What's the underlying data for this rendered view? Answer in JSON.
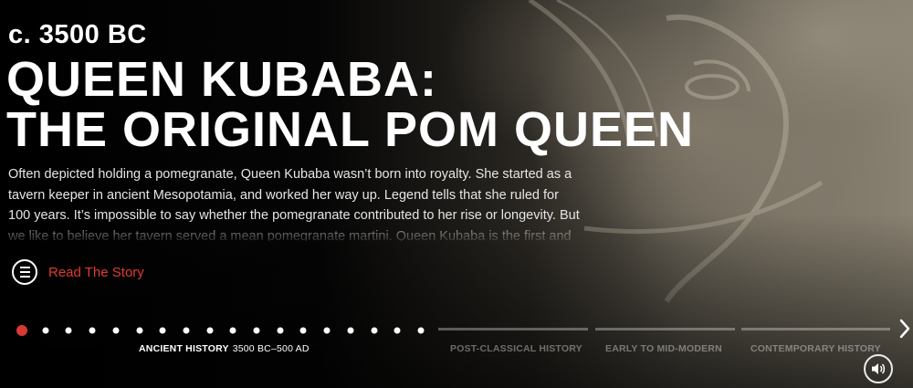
{
  "hero": {
    "era_date": "c. 3500 BC",
    "title_lines": [
      "QUEEN KUBABA:",
      "THE ORIGINAL POM QUEEN"
    ],
    "description": "Often depicted holding a pomegranate, Queen Kubaba wasn’t born into royalty. She started as a tavern keeper in ancient Mesopotamia, and worked her way up. Legend tells that she ruled for 100 years. It’s impossible to say whether the pomegranate contributed to her rise or longevity. But we like to believe her tavern served a mean pomegranate martini. Queen Kubaba is the first and only",
    "read_story_label": "Read The Story",
    "menu_icon": "menu-lines-icon"
  },
  "timeline": {
    "dot_count": 18,
    "active_dot_index": 0,
    "accent_color": "#d73a33",
    "current_era": {
      "name": "ANCIENT HISTORY",
      "range": "3500 BC–500 AD"
    },
    "other_eras": [
      "POST-CLASSICAL HISTORY",
      "EARLY TO MID-MODERN",
      "CONTEMPORARY HISTORY"
    ],
    "next_icon": "chevron-right-icon"
  },
  "controls": {
    "sound_icon": "speaker-icon"
  }
}
